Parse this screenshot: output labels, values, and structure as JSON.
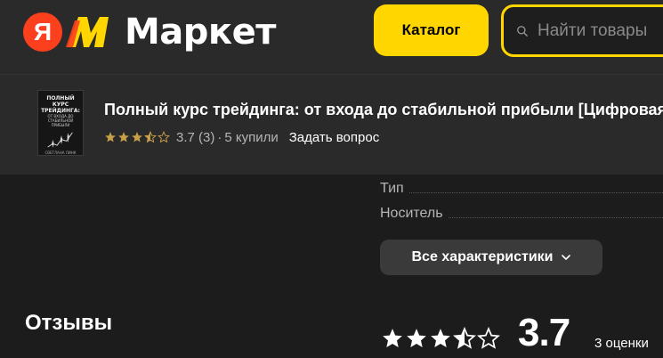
{
  "header": {
    "logo_letter": "Я",
    "brand": "Маркет",
    "catalog_label": "Каталог",
    "search_placeholder": "Найти товары"
  },
  "product": {
    "title": "Полный курс трейдинга: от входа до стабильной прибыли [Цифровая версия]",
    "rating": 3.5,
    "rating_text": "3.7 (3)",
    "separator": "·",
    "buyers": "5 купили",
    "ask_question": "Задать вопрос",
    "cover": {
      "title": "ПОЛНЫЙ КУРС ТРЕЙДИНГА:",
      "subtitle": "ОТ ВХОДА ДО СТАБИЛЬНОЙ ПРИБЫЛИ",
      "author": "СВЕТЛАНА ЛИНК"
    }
  },
  "specs": [
    {
      "label": "Тип"
    },
    {
      "label": "Носитель"
    }
  ],
  "all_specs_label": "Все характеристики",
  "reviews": {
    "title": "Отзывы",
    "rating_value": "3.7",
    "stars": 3.5,
    "count_label": "3 оценки"
  },
  "colors": {
    "accent_yellow": "#ffd600",
    "logo_red": "#fc3f1d",
    "star_color": "#c8a048",
    "background": "#1c1c1c"
  }
}
